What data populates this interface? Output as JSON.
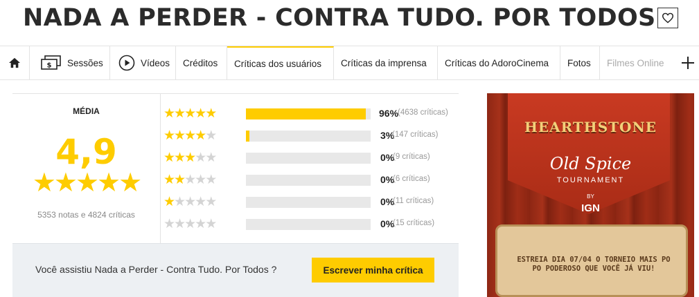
{
  "page": {
    "title": "NADA A PERDER - CONTRA TUDO. POR TODOS"
  },
  "nav": {
    "items": [
      {
        "label": "",
        "icon": "home-icon"
      },
      {
        "label": "Sessões",
        "icon": "tickets-icon"
      },
      {
        "label": "Vídeos",
        "icon": "play-icon"
      },
      {
        "label": "Créditos"
      },
      {
        "label": "Críticas dos usuários",
        "active": true
      },
      {
        "label": "Críticas da imprensa"
      },
      {
        "label": "Críticas do AdoroCinema"
      },
      {
        "label": "Fotos"
      },
      {
        "label": "Filmes Online",
        "disabled": true
      },
      {
        "label": "",
        "icon": "plus-icon"
      }
    ]
  },
  "rating": {
    "label": "MÉDIA",
    "score": "4,9",
    "stars": "★★★★★",
    "summary": "5353 notas e 4824 críticas",
    "breakdown": [
      {
        "stars": 5,
        "pct_value": 96,
        "pct": "96%",
        "count": "(4638 críticas)"
      },
      {
        "stars": 4,
        "pct_value": 3,
        "pct": "3%",
        "count": "(147 críticas)"
      },
      {
        "stars": 3,
        "pct_value": 0,
        "pct": "0%",
        "count": "(9 críticas)"
      },
      {
        "stars": 2,
        "pct_value": 0,
        "pct": "0%",
        "count": "(6 críticas)"
      },
      {
        "stars": 1,
        "pct_value": 0,
        "pct": "0%",
        "count": "(11 críticas)"
      },
      {
        "stars": 0,
        "pct_value": 0,
        "pct": "0%",
        "count": "(15 críticas)"
      }
    ]
  },
  "cta": {
    "question": "Você assistiu Nada a Perder - Contra Tudo. Por Todos ?",
    "button": "Escrever minha crítica"
  },
  "ad": {
    "game_logo": "HEARTHSTONE",
    "brand": "Old Spice",
    "event": "TOURNAMENT",
    "by": "BY",
    "sponsor": "IGN",
    "promo": "ESTREIA DIA 07/04 O TORNEIO MAIS PO PO PODEROSO QUE VOCÊ JÁ VIU!"
  },
  "colors": {
    "accent": "#fecc00",
    "bar_track": "#e8e8e8",
    "cta_bg": "#edf0f3"
  }
}
